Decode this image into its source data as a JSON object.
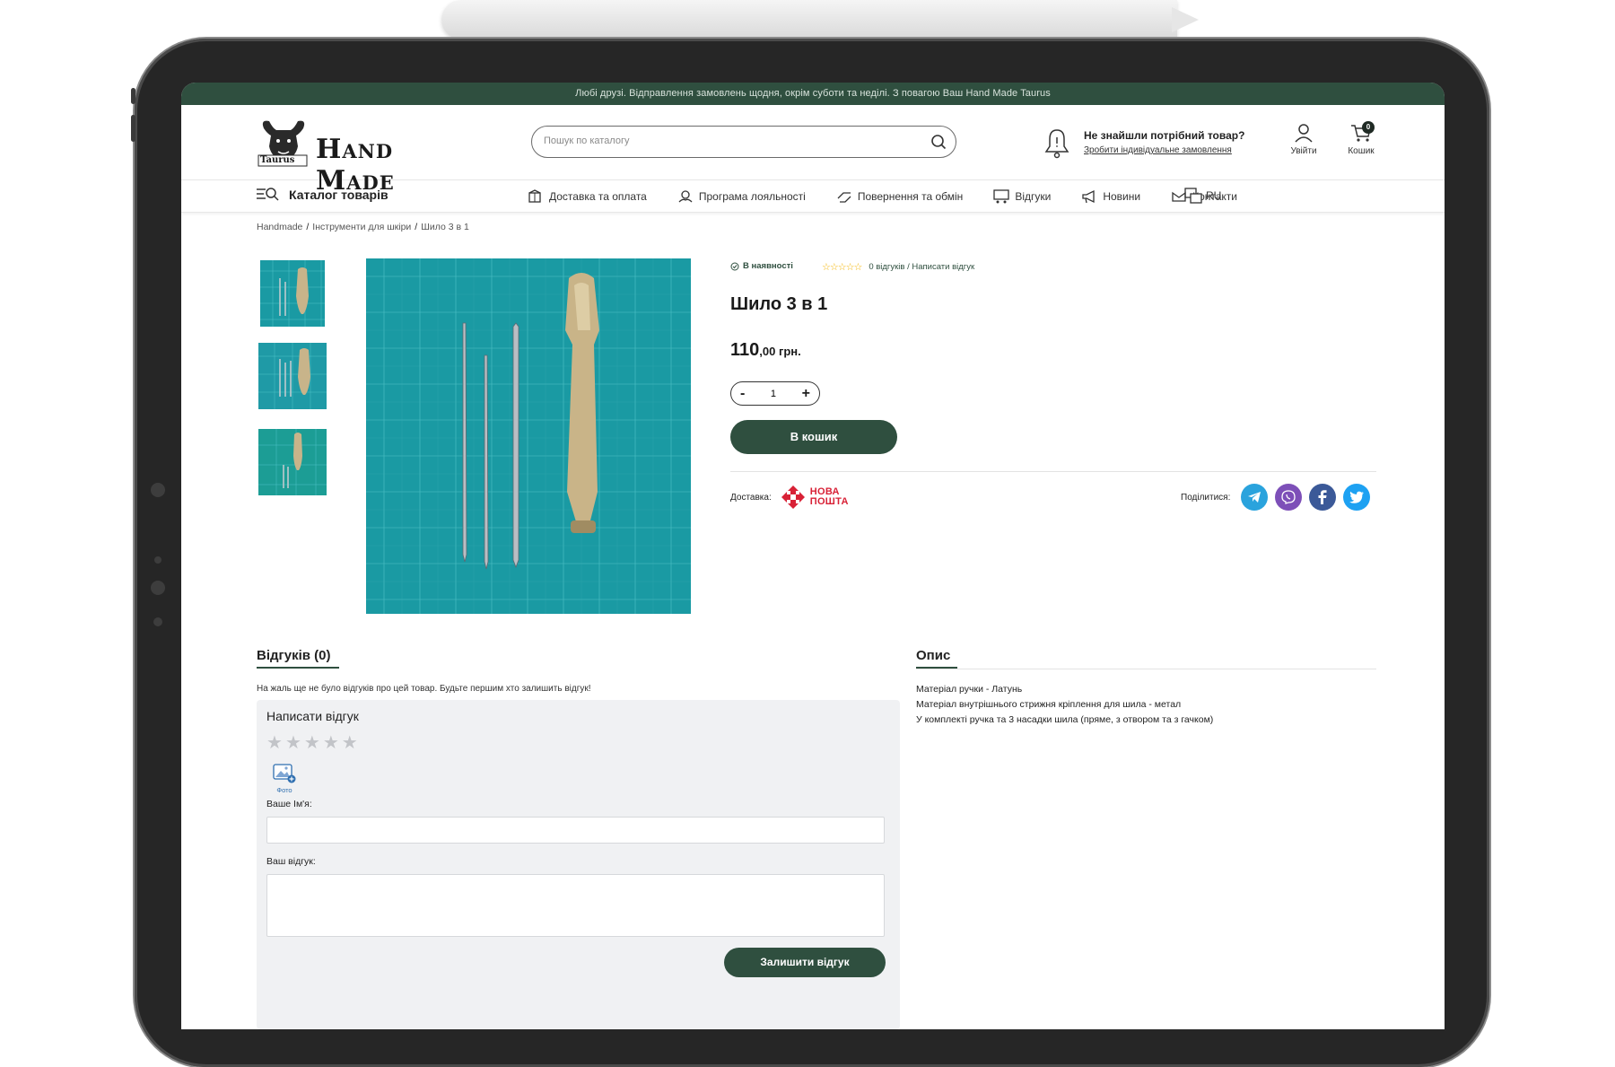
{
  "announcement": "Любі друзі. Відправлення замовлень щодня, окрім суботи та неділі. З повагою Ваш Hand Made Taurus",
  "header": {
    "logo_text": "Hand Made",
    "logo_sub": "Taurus",
    "search_placeholder": "Пошук по каталогу",
    "custom_order_title": "Не знайшли потрібний товар?",
    "custom_order_link": "Зробити індивідуальне замовлення",
    "login_label": "Увійти",
    "cart_label": "Кошик",
    "cart_count": "0"
  },
  "nav": {
    "catalog_label": "Каталог товарів",
    "items": [
      {
        "label": "Доставка та оплата",
        "icon": "delivery-icon"
      },
      {
        "label": "Програма лояльності",
        "icon": "loyalty-icon"
      },
      {
        "label": "Повернення та обмін",
        "icon": "return-icon"
      },
      {
        "label": "Відгуки",
        "icon": "reviews-icon"
      },
      {
        "label": "Новини",
        "icon": "megaphone-icon"
      },
      {
        "label": "Контакти",
        "icon": "contacts-icon"
      }
    ],
    "lang": "RU"
  },
  "breadcrumbs": [
    "Handmade",
    "Інструменти для шкіри",
    "Шило 3 в 1"
  ],
  "product": {
    "stock": "В наявності",
    "reviews_link": "0 відгуків / Написати відгук",
    "rating": 0,
    "title": "Шило 3 в 1",
    "price_main": "110",
    "price_fraction": ",00 грн.",
    "qty_minus": "-",
    "qty_value": "1",
    "qty_plus": "+",
    "add_to_cart": "В кошик",
    "delivery_label": "Доставка:",
    "delivery_carrier_line1": "НОВА",
    "delivery_carrier_line2": "ПОШТА",
    "share_label": "Поділитися:"
  },
  "share_icons": [
    "telegram-icon",
    "viber-icon",
    "facebook-icon",
    "twitter-icon"
  ],
  "colors": {
    "accent": "#2f4f3f",
    "telegram": "#2aa3dd",
    "viber": "#7d4fb8",
    "facebook": "#3b5998",
    "twitter": "#1da1f2",
    "nova_poshta": "#d82136",
    "image_bg": "#1a9aa3"
  },
  "reviews": {
    "heading": "Відгуків (0)",
    "empty_text": "На жаль ще не було відгуків про цей товар. Будьте першим хто залишить відгук!",
    "form_title": "Написати відгук",
    "photo_label": "Фото",
    "name_label": "Ваше Ім'я:",
    "review_label": "Ваш відгук:",
    "submit_label": "Залишити відгук"
  },
  "description": {
    "heading": "Опис",
    "lines": [
      "Матеріал ручки - Латунь",
      "Матеріал внутрішнього стрижня кріплення для шила - метал",
      "У комплекті ручка та 3 насадки шила (пряме, з отвором та з гачком)"
    ]
  }
}
